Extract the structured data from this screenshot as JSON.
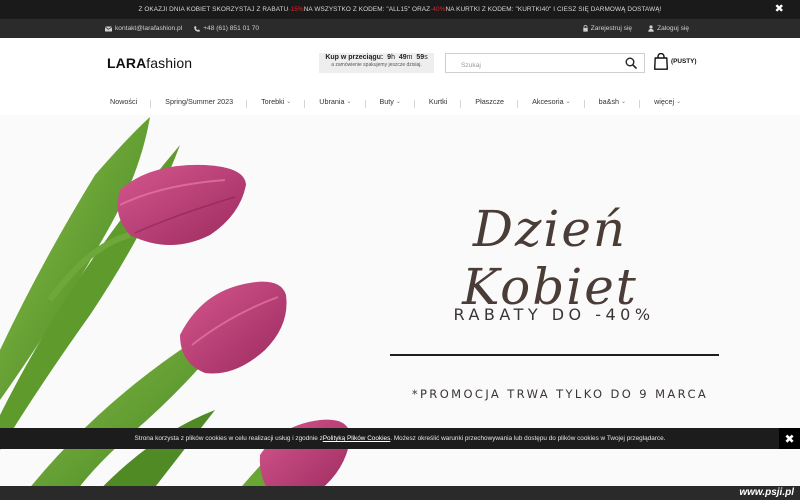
{
  "promo_bar": {
    "part1": "Z OKAZJI DNIA KOBIET SKORZYSTAJ Z RABATU ",
    "discount1": "-15%",
    "part2": " NA WSZYSTKO Z KODEM: \"ALL15\" ORAZ ",
    "discount2": "-40%",
    "part3": " NA KURTKI Z KODEM: \"KURTKI40\" I CIESZ SIĘ DARMOWĄ DOSTAWĄ!",
    "close": "✖"
  },
  "contact": {
    "email": "kontakt@larafashion.pl",
    "phone": "+48 (61) 851 01 70",
    "register": "Zarejestruj się",
    "login": "Zaloguj się"
  },
  "header": {
    "logo_bold": "LARA",
    "logo_light": "fashion",
    "countdown": {
      "label": "Kup w przeciągu:",
      "hours": "9",
      "h_unit": "h",
      "minutes": "49",
      "m_unit": "m",
      "seconds": "59",
      "s_unit": "s",
      "note": "a zamówienie spakujemy jeszcze dzisiaj."
    },
    "search_placeholder": "Szukaj",
    "cart_label": "(PUSTY)"
  },
  "nav": {
    "items": [
      {
        "label": "Nowości"
      },
      {
        "label": "Spring/Summer 2023"
      },
      {
        "label": "Torebki"
      },
      {
        "label": "Ubrania"
      },
      {
        "label": "Buty"
      },
      {
        "label": "Kurtki"
      },
      {
        "label": "Płaszcze"
      },
      {
        "label": "Akcesoria"
      },
      {
        "label": "ba&sh"
      },
      {
        "label": "więcej"
      }
    ]
  },
  "hero": {
    "title": "Dzień Kobiet",
    "subtitle": "RABATY DO -40%",
    "promo": "*PROMOCJA TRWA TYLKO DO 9 MARCA"
  },
  "cookie": {
    "text1": "Strona korzysta z plików cookies w celu realizacji usług i zgodnie z ",
    "link": "Polityką Plików Cookies",
    "text2": ". Możesz określić warunki przechowywania lub dostępu do plików cookies w Twojej przeglądarce.",
    "close": "✖"
  },
  "watermark": "www.psji.pl",
  "colors": {
    "accent_red": "#e0202e",
    "tulip": "#b8336f",
    "stem": "#5e9a2c"
  }
}
